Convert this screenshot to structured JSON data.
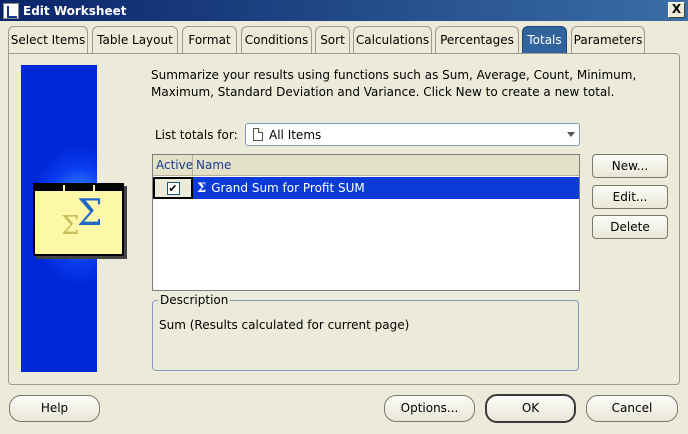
{
  "window": {
    "title": "Edit Worksheet",
    "close_label": "X"
  },
  "tabs": [
    {
      "label": "Select Items",
      "active": false
    },
    {
      "label": "Table Layout",
      "active": false
    },
    {
      "label": "Format",
      "active": false
    },
    {
      "label": "Conditions",
      "active": false
    },
    {
      "label": "Sort",
      "active": false
    },
    {
      "label": "Calculations",
      "active": false
    },
    {
      "label": "Percentages",
      "active": false
    },
    {
      "label": "Totals",
      "active": true
    },
    {
      "label": "Parameters",
      "active": false
    }
  ],
  "totals": {
    "description": "Summarize your results using functions such as Sum, Average, Count, Minimum, Maximum, Standard Deviation and Variance. Click New to create a new total.",
    "list_label": "List totals for:",
    "list_value": "All Items",
    "columns": {
      "active": "Active",
      "name": "Name"
    },
    "rows": [
      {
        "active": true,
        "name": "Grand Sum for Profit SUM",
        "check_glyph": "✔",
        "icon": "Σ"
      }
    ],
    "buttons": {
      "new": "New...",
      "edit": "Edit...",
      "delete": "Delete"
    },
    "description_legend": "Description",
    "description_value": "Sum (Results calculated for current page)",
    "art": {
      "sigma_large": "Σ",
      "sigma_small": "Σ"
    }
  },
  "footer": {
    "help": "Help",
    "options": "Options...",
    "ok": "OK",
    "cancel": "Cancel"
  },
  "colors": {
    "title_bar": "#0a246a",
    "active_tab": "#31639c",
    "selection": "#0a3bd8"
  },
  "icons": {
    "window": "worksheet-icon",
    "list": "document-icon",
    "sigma": "sigma-icon",
    "dropdown": "chevron-down-icon"
  }
}
